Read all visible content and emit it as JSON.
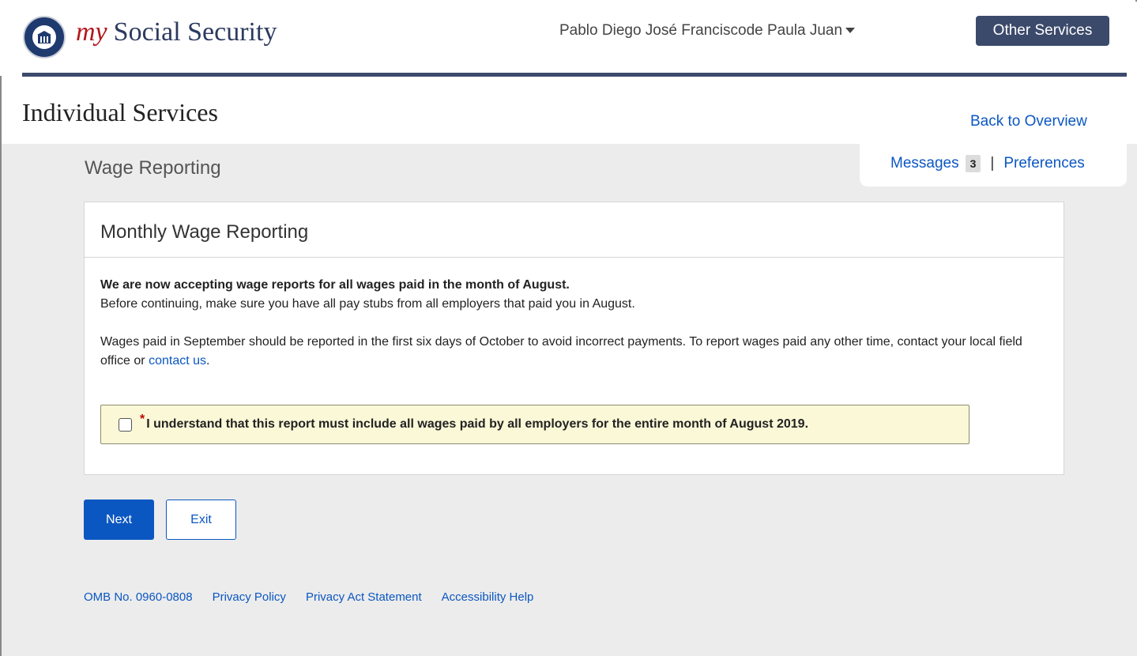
{
  "header": {
    "brand_my": "my",
    "brand_name": "Social Security",
    "user_name": "Pablo Diego José Franciscode Paula Juan",
    "other_services": "Other Services"
  },
  "section": {
    "title": "Individual Services",
    "back_link": "Back to Overview"
  },
  "utility": {
    "messages_label": "Messages",
    "messages_count": "3",
    "separator": "|",
    "preferences_label": "Preferences"
  },
  "page": {
    "heading": "Wage Reporting"
  },
  "card": {
    "title": "Monthly Wage Reporting",
    "lead": "We are now accepting wage reports for all wages paid in the month of August.",
    "line2": "Before continuing, make sure you have all pay stubs from all employers that paid you in August.",
    "para2_text": "Wages paid in September should be reported in the first six days of October to avoid incorrect payments. To report wages paid any other time, contact your local field office or ",
    "para2_link": "contact us",
    "para2_end": ".",
    "ack_required_marker": "*",
    "ack_text": "I understand that this report must include all wages paid by all employers for the entire month of August 2019.",
    "ack_checked": false
  },
  "buttons": {
    "next": "Next",
    "exit": "Exit"
  },
  "footer": {
    "omb": "OMB No. 0960-0808",
    "privacy_policy": "Privacy Policy",
    "privacy_act": "Privacy Act Statement",
    "accessibility": "Accessibility Help"
  },
  "colors": {
    "primary_blue": "#0b57c2",
    "header_navy": "#3b4a6b",
    "brand_red": "#b3161c",
    "ack_background": "#fbf8d7",
    "content_gray": "#ececec"
  }
}
